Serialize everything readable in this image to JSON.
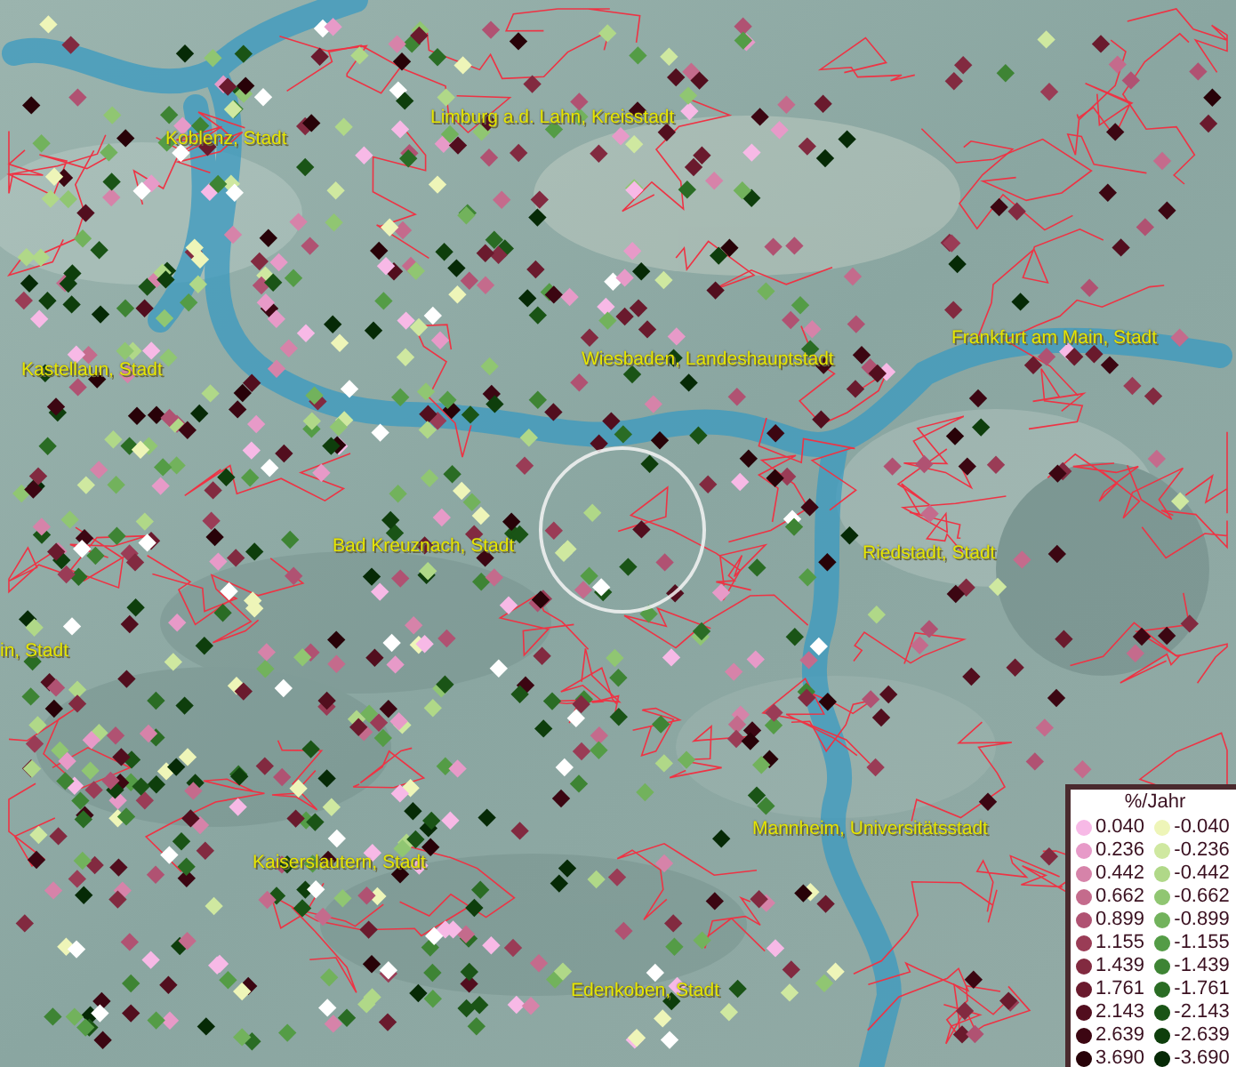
{
  "places": [
    {
      "name": "Koblenz, Stadt"
    },
    {
      "name": "Limburg a.d. Lahn, Kreisstadt"
    },
    {
      "name": "Frankfurt am Main, Stadt"
    },
    {
      "name": "Kastellaun, Stadt"
    },
    {
      "name": "Wiesbaden, Landeshauptstadt"
    },
    {
      "name": "Bad Kreuznach, Stadt"
    },
    {
      "name": "Riedstadt, Stadt"
    },
    {
      "name": "in, Stadt"
    },
    {
      "name": "Mannheim, Universitätsstadt"
    },
    {
      "name": "Kaiserslautern, Stadt"
    },
    {
      "name": "Edenkoben, Stadt"
    }
  ],
  "legend": {
    "title": "%/Jahr",
    "positive": [
      {
        "value": "0.040",
        "color": "#f7b9e6"
      },
      {
        "value": "0.236",
        "color": "#e79ac8"
      },
      {
        "value": "0.442",
        "color": "#d683a9"
      },
      {
        "value": "0.662",
        "color": "#c46b8c"
      },
      {
        "value": "0.899",
        "color": "#b05272"
      },
      {
        "value": "1.155",
        "color": "#9a3c56"
      },
      {
        "value": "1.439",
        "color": "#822a40"
      },
      {
        "value": "1.761",
        "color": "#6a1a2d"
      },
      {
        "value": "2.143",
        "color": "#520e1e"
      },
      {
        "value": "2.639",
        "color": "#3c0612"
      },
      {
        "value": "3.690",
        "color": "#280208"
      }
    ],
    "negative": [
      {
        "value": "-0.040",
        "color": "#eef5b8"
      },
      {
        "value": "-0.236",
        "color": "#cfe8a0"
      },
      {
        "value": "-0.442",
        "color": "#b0d888"
      },
      {
        "value": "-0.662",
        "color": "#90c672"
      },
      {
        "value": "-0.899",
        "color": "#72b25c"
      },
      {
        "value": "-1.155",
        "color": "#549c46"
      },
      {
        "value": "-1.439",
        "color": "#3e8434"
      },
      {
        "value": "-1.761",
        "color": "#2a6c24"
      },
      {
        "value": "-2.143",
        "color": "#1a5416"
      },
      {
        "value": "-2.639",
        "color": "#0e3e0c"
      },
      {
        "value": "-3.690",
        "color": "#062a06"
      }
    ]
  }
}
